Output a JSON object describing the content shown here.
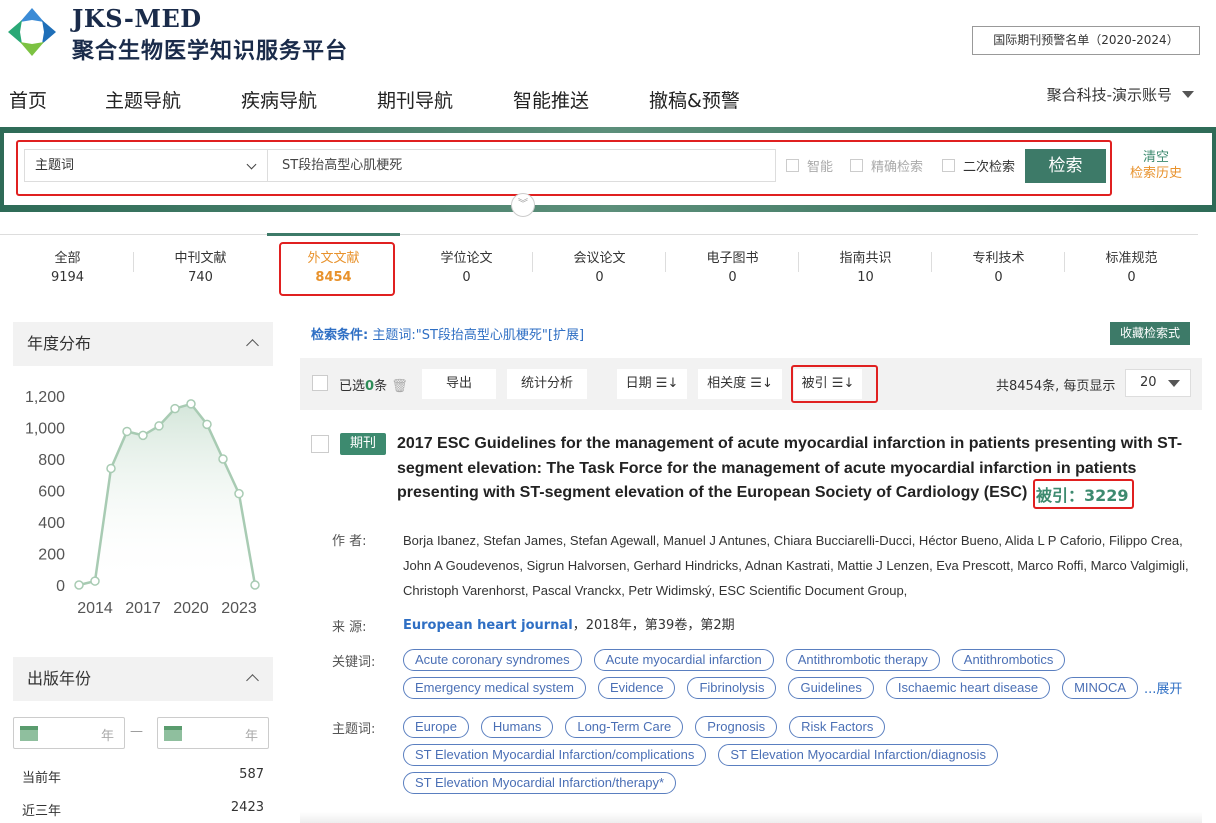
{
  "header": {
    "logo_en": "JKS-MED",
    "logo_cn": "聚合生物医学知识服务平台",
    "warning_list": "国际期刊预警名单（2020-2024）",
    "account": "聚合科技-演示账号"
  },
  "nav": [
    "首页",
    "主题导航",
    "疾病导航",
    "期刊导航",
    "智能推送",
    "撤稿&预警"
  ],
  "search": {
    "field": "主题词",
    "query": "ST段抬高型心肌梗死",
    "options": [
      "智能",
      "精确检索",
      "二次检索"
    ],
    "button": "检索",
    "clear": "清空",
    "history": "检索历史"
  },
  "tabs": [
    {
      "label": "全部",
      "count": "9194"
    },
    {
      "label": "中刊文献",
      "count": "740"
    },
    {
      "label": "外文文献",
      "count": "8454"
    },
    {
      "label": "学位论文",
      "count": "0"
    },
    {
      "label": "会议论文",
      "count": "0"
    },
    {
      "label": "电子图书",
      "count": "0"
    },
    {
      "label": "指南共识",
      "count": "10"
    },
    {
      "label": "专利技术",
      "count": "0"
    },
    {
      "label": "标准规范",
      "count": "0"
    }
  ],
  "left": {
    "year_dist_title": "年度分布",
    "pub_year_title": "出版年份",
    "year_placeholder": "年",
    "dash": "—",
    "stats": [
      {
        "label": "当前年",
        "value": "587"
      },
      {
        "label": "近三年",
        "value": "2423"
      }
    ]
  },
  "chart_data": {
    "type": "line",
    "x": [
      2013,
      2014,
      2015,
      2016,
      2017,
      2018,
      2019,
      2020,
      2021,
      2022,
      2023,
      2024
    ],
    "values": [
      0,
      25,
      740,
      975,
      950,
      1010,
      1120,
      1150,
      1020,
      800,
      580,
      0
    ],
    "xticks": [
      "2014",
      "2017",
      "2020",
      "2023"
    ],
    "yticks": [
      "0",
      "200",
      "400",
      "600",
      "800",
      "1,000",
      "1,200"
    ],
    "ylim": [
      0,
      1200
    ],
    "color": "#a8cbb3"
  },
  "results": {
    "cond_label": "检索条件:",
    "cond_text": "主题词:\"ST段抬高型心肌梗死\"[扩展]",
    "save_query": "收藏检索式",
    "selected_prefix": "已选",
    "selected_count": "0",
    "selected_suffix": "条",
    "export": "导出",
    "analysis": "统计分析",
    "sort_date": "日期 ☰↓",
    "sort_relevance": "相关度 ☰↓",
    "sort_cited": "被引 ☰↓",
    "total_text": "共8454条, 每页显示",
    "per_page": "20"
  },
  "item": {
    "badge": "期刊",
    "title": "2017 ESC Guidelines for the management of acute myocardial infarction in patients presenting with ST-segment elevation: The Task Force for the management of acute myocardial infarction in patients presenting with ST-segment elevation of the European Society of Cardiology (ESC)",
    "cited": "被引：3229",
    "authors_label": "作 者:",
    "authors": "Borja Ibanez,  Stefan James,  Stefan Agewall,  Manuel J Antunes,  Chiara Bucciarelli-Ducci,  Héctor Bueno,  Alida L P Caforio,  Filippo Crea,  John A Goudevenos,  Sigrun Halvorsen,  Gerhard Hindricks,  Adnan Kastrati,  Mattie J Lenzen,  Eva Prescott,  Marco Roffi,  Marco Valgimigli,  Christoph Varenhorst,  Pascal Vranckx,  Petr Widimský,  ESC Scientific Document Group,",
    "source_label": "来 源:",
    "journal": "European heart journal",
    "source_rest": "，2018年，第39卷，第2期",
    "keywords_label": "关键词:",
    "keywords": [
      "Acute coronary syndromes",
      "Acute myocardial infarction",
      "Antithrombotic therapy",
      "Antithrombotics",
      "Emergency medical system",
      "Evidence",
      "Fibrinolysis",
      "Guidelines",
      "Ischaemic heart disease",
      "MINOCA"
    ],
    "expand": "...展开",
    "subjects_label": "主题词:",
    "subjects": [
      "Europe",
      "Humans",
      "Long-Term Care",
      "Prognosis",
      "Risk Factors",
      "ST Elevation Myocardial Infarction/complications",
      "ST Elevation Myocardial Infarction/diagnosis",
      "ST Elevation Myocardial Infarction/therapy*"
    ]
  }
}
